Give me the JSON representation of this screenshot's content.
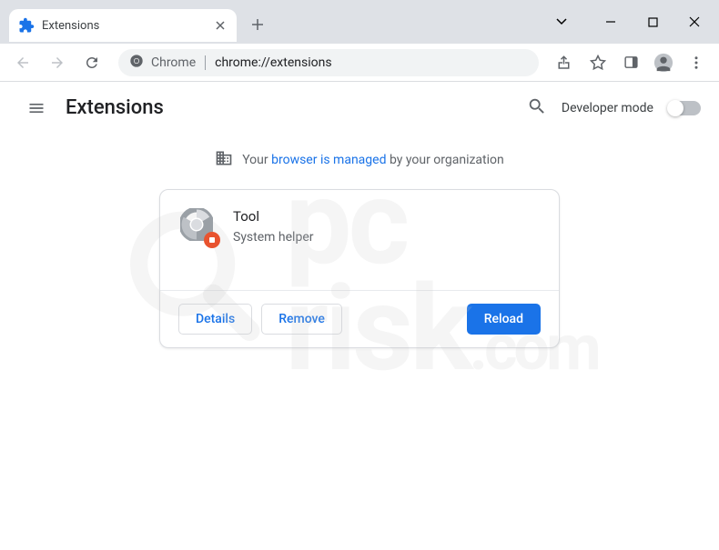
{
  "tab": {
    "title": "Extensions"
  },
  "omnibox": {
    "scheme": "Chrome",
    "path": "chrome://extensions"
  },
  "page": {
    "title": "Extensions",
    "dev_mode_label": "Developer mode"
  },
  "managed": {
    "prefix": "Your ",
    "link": "browser is managed",
    "suffix": " by your organization"
  },
  "extension": {
    "name": "Tool",
    "description": "System helper",
    "details_label": "Details",
    "remove_label": "Remove",
    "reload_label": "Reload"
  },
  "watermark": {
    "line1": "pc",
    "line2": "risk",
    "suffix": ".com"
  }
}
